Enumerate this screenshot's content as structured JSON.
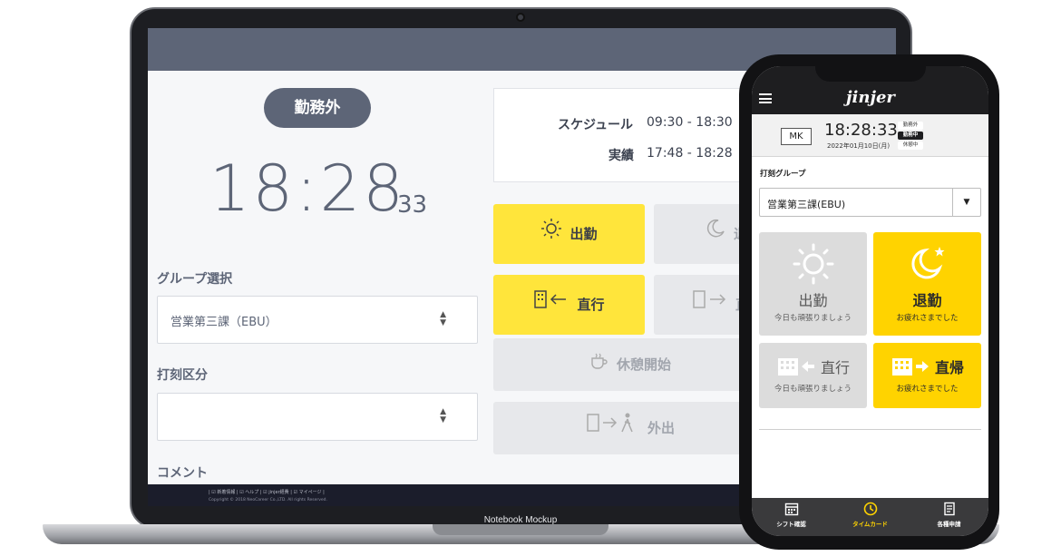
{
  "laptop": {
    "status_label": "勤務外",
    "clock": {
      "hm": "18:28",
      "sec": "33"
    },
    "group_label": "グループ選択",
    "group_value": "営業第三課（EBU）",
    "stamp_label": "打刻区分",
    "stamp_value": "",
    "comment_label": "コメント",
    "schedule": {
      "label": "スケジュール",
      "value": "09:30 - 18:30"
    },
    "actual": {
      "label": "実績",
      "value": "17:48 - 18:28"
    },
    "buttons": {
      "clock_in": "出勤",
      "clock_out": "退",
      "direct_go": "直行",
      "direct_return": "直",
      "break_start": "休憩開始",
      "go_out": "外出"
    },
    "footer_links": "| ☑ 新着情報 | ☑ ヘルプ | ☑ jinjer経費 | ☑ マイページ |",
    "footer_copy": "Copyright © 2018 NeoCareer Co.,LTD. All rights Reserved.",
    "mockup_label": "Notebook Mockup"
  },
  "phone": {
    "logo": "jinjer",
    "user_badge": "MK",
    "time": "18:28:33",
    "date": "2022年01月10日(月)",
    "tags": [
      "勤務外",
      "勤務中",
      "休憩中"
    ],
    "group_label": "打刻グループ",
    "group_value": "営業第三課(EBU)",
    "tiles": [
      {
        "main": "出勤",
        "sub": "今日も頑張りましょう"
      },
      {
        "main": "退勤",
        "sub": "お疲れさまでした"
      },
      {
        "main": "直行",
        "sub": "今日も頑張りましょう"
      },
      {
        "main": "直帰",
        "sub": "お疲れさまでした"
      }
    ],
    "tabs": [
      {
        "label": "シフト確認",
        "icon": "calendar-icon"
      },
      {
        "label": "タイムカード",
        "icon": "clock-icon"
      },
      {
        "label": "各種申請",
        "icon": "document-icon"
      }
    ]
  },
  "colors": {
    "accent_yellow": "#ffd300",
    "laptop_yellow": "#ffe53b",
    "slate": "#5d6577"
  }
}
